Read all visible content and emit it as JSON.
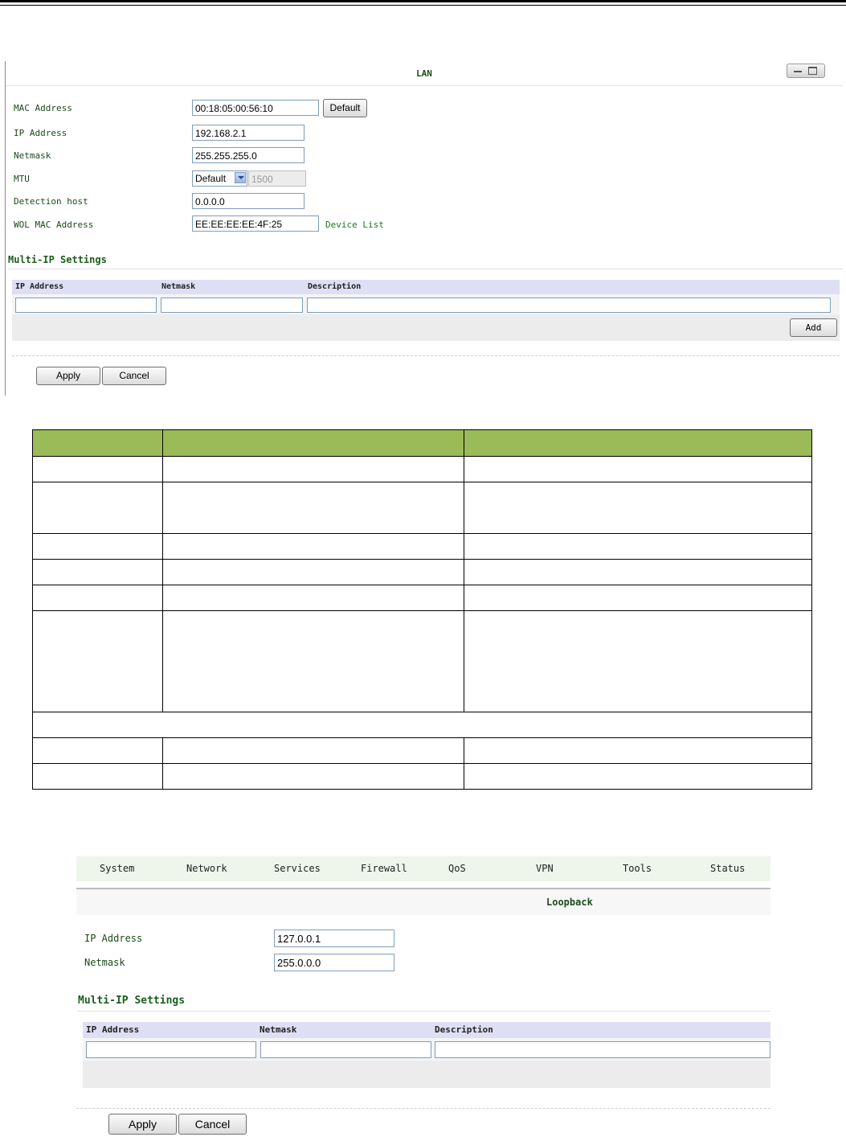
{
  "lan": {
    "title": "LAN",
    "mac_label": "MAC Address",
    "mac_value": "00:18:05:00:56:10",
    "default_button": "Default",
    "ip_label": "IP Address",
    "ip_value": "192.168.2.1",
    "netmask_label": "Netmask",
    "netmask_value": "255.255.255.0",
    "mtu_label": "MTU",
    "mtu_select": "Default",
    "mtu_value": "1500",
    "detection_label": "Detection host",
    "detection_value": "0.0.0.0",
    "wol_label": "WOL MAC Address",
    "wol_value": "EE:EE:EE:EE:4F:25",
    "device_list_link": "Device List",
    "multi_ip_title": "Multi-IP Settings",
    "grid_headers": [
      "IP Address",
      "Netmask",
      "Description"
    ],
    "add_button": "Add",
    "apply_button": "Apply",
    "cancel_button": "Cancel"
  },
  "table": {
    "header_color": "#9bbb59",
    "rows": 9
  },
  "loopback": {
    "menu": [
      "System",
      "Network",
      "Services",
      "Firewall",
      "QoS",
      "VPN",
      "Tools",
      "Status"
    ],
    "title": "Loopback",
    "ip_label": "IP Address",
    "ip_value": "127.0.0.1",
    "netmask_label": "Netmask",
    "netmask_value": "255.0.0.0",
    "multi_ip_title": "Multi-IP Settings",
    "grid_headers": [
      "IP Address",
      "Netmask",
      "Description"
    ],
    "apply_button": "Apply",
    "cancel_button": "Cancel"
  }
}
